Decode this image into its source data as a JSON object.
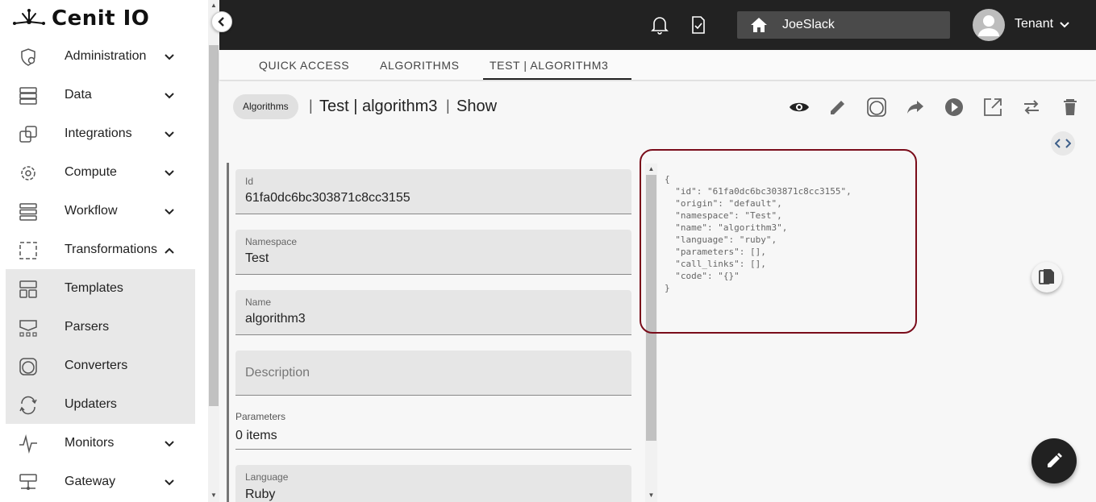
{
  "app": {
    "title": "Cenit IO"
  },
  "sidebar": {
    "items": [
      {
        "label": "Administration",
        "icon": "admin-icon",
        "chevron": "down"
      },
      {
        "label": "Data",
        "icon": "data-icon",
        "chevron": "down"
      },
      {
        "label": "Integrations",
        "icon": "integrations-icon",
        "chevron": "down"
      },
      {
        "label": "Compute",
        "icon": "compute-icon",
        "chevron": "down"
      },
      {
        "label": "Workflow",
        "icon": "workflow-icon",
        "chevron": "down"
      },
      {
        "label": "Transformations",
        "icon": "transformations-icon",
        "chevron": "up"
      }
    ],
    "subitems": [
      {
        "label": "Templates",
        "icon": "templates-icon"
      },
      {
        "label": "Parsers",
        "icon": "parsers-icon"
      },
      {
        "label": "Converters",
        "icon": "converters-icon"
      },
      {
        "label": "Updaters",
        "icon": "updaters-icon"
      }
    ],
    "bottom_items": [
      {
        "label": "Monitors",
        "icon": "monitors-icon",
        "chevron": "down"
      },
      {
        "label": "Gateway",
        "icon": "gateway-icon",
        "chevron": "down"
      }
    ]
  },
  "topbar": {
    "tenant_name": "JoeSlack",
    "tenant_label": "Tenant"
  },
  "tabs": [
    {
      "label": "QUICK ACCESS",
      "active": false
    },
    {
      "label": "ALGORITHMS",
      "active": false
    },
    {
      "label": "TEST | ALGORITHM3",
      "active": true
    }
  ],
  "breadcrumb": {
    "chip": "Algorithms",
    "title": "Test | algorithm3",
    "action": "Show"
  },
  "form": {
    "id": {
      "label": "Id",
      "value": "61fa0dc6bc303871c8cc3155"
    },
    "namespace": {
      "label": "Namespace",
      "value": "Test"
    },
    "name": {
      "label": "Name",
      "value": "algorithm3"
    },
    "description": {
      "placeholder": "Description"
    },
    "parameters": {
      "label": "Parameters",
      "value": "0 items"
    },
    "language": {
      "label": "Language",
      "value": "Ruby"
    }
  },
  "json_view": "{\n  \"id\": \"61fa0dc6bc303871c8cc3155\",\n  \"origin\": \"default\",\n  \"namespace\": \"Test\",\n  \"name\": \"algorithm3\",\n  \"language\": \"ruby\",\n  \"parameters\": [],\n  \"call_links\": [],\n  \"code\": \"{}\"\n}",
  "colors": {
    "topbar": "#222222",
    "highlight": "#7a0c1a",
    "fab": "#212121"
  }
}
